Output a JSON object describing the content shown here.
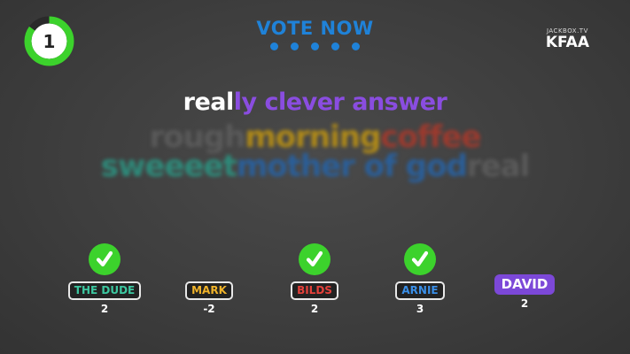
{
  "timer": {
    "value": "1",
    "progress": 0.85,
    "ring_color": "#3cd22c"
  },
  "header": {
    "title": "VOTE NOW",
    "dot_count": 5,
    "accent": "#1f82d8"
  },
  "brand": {
    "site": "JACKBOX.TV",
    "room_code": "KFAA"
  },
  "answer": {
    "prefix": "real",
    "rest": "ly clever answer"
  },
  "word_cloud": {
    "row1": [
      {
        "text": "rough",
        "color": "#5a5a5a"
      },
      {
        "text": "morning",
        "color": "#b08a18"
      },
      {
        "text": "coffee",
        "color": "#9c3a2e"
      }
    ],
    "row2": [
      {
        "text": "sweeeet",
        "color": "#2e8a7a"
      },
      {
        "text": "mother of god",
        "color": "#2a5f9a"
      },
      {
        "text": "real",
        "color": "#5a5a5a"
      }
    ]
  },
  "players": [
    {
      "name": "THE DUDE",
      "score": "2",
      "voted": true,
      "color": "#3cc7a0"
    },
    {
      "name": "MARK",
      "score": "-2",
      "voted": false,
      "color": "#f0b32a"
    },
    {
      "name": "BILDS",
      "score": "2",
      "voted": true,
      "color": "#e6413b"
    },
    {
      "name": "ARNIE",
      "score": "3",
      "voted": true,
      "color": "#3a8fe8"
    },
    {
      "name": "DAVID",
      "score": "2",
      "voted": false,
      "color": "#ffffff"
    }
  ]
}
